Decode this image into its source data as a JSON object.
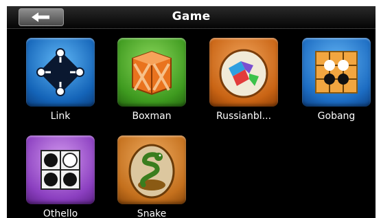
{
  "header": {
    "title": "Game",
    "back_icon": "back-arrow-icon"
  },
  "games": [
    {
      "label": "Link",
      "icon": "link-icon"
    },
    {
      "label": "Boxman",
      "icon": "boxman-icon"
    },
    {
      "label": "Russianbl...",
      "icon": "russianblock-icon"
    },
    {
      "label": "Gobang",
      "icon": "gobang-icon"
    },
    {
      "label": "Othello",
      "icon": "othello-icon"
    },
    {
      "label": "Snake",
      "icon": "snake-icon"
    }
  ]
}
